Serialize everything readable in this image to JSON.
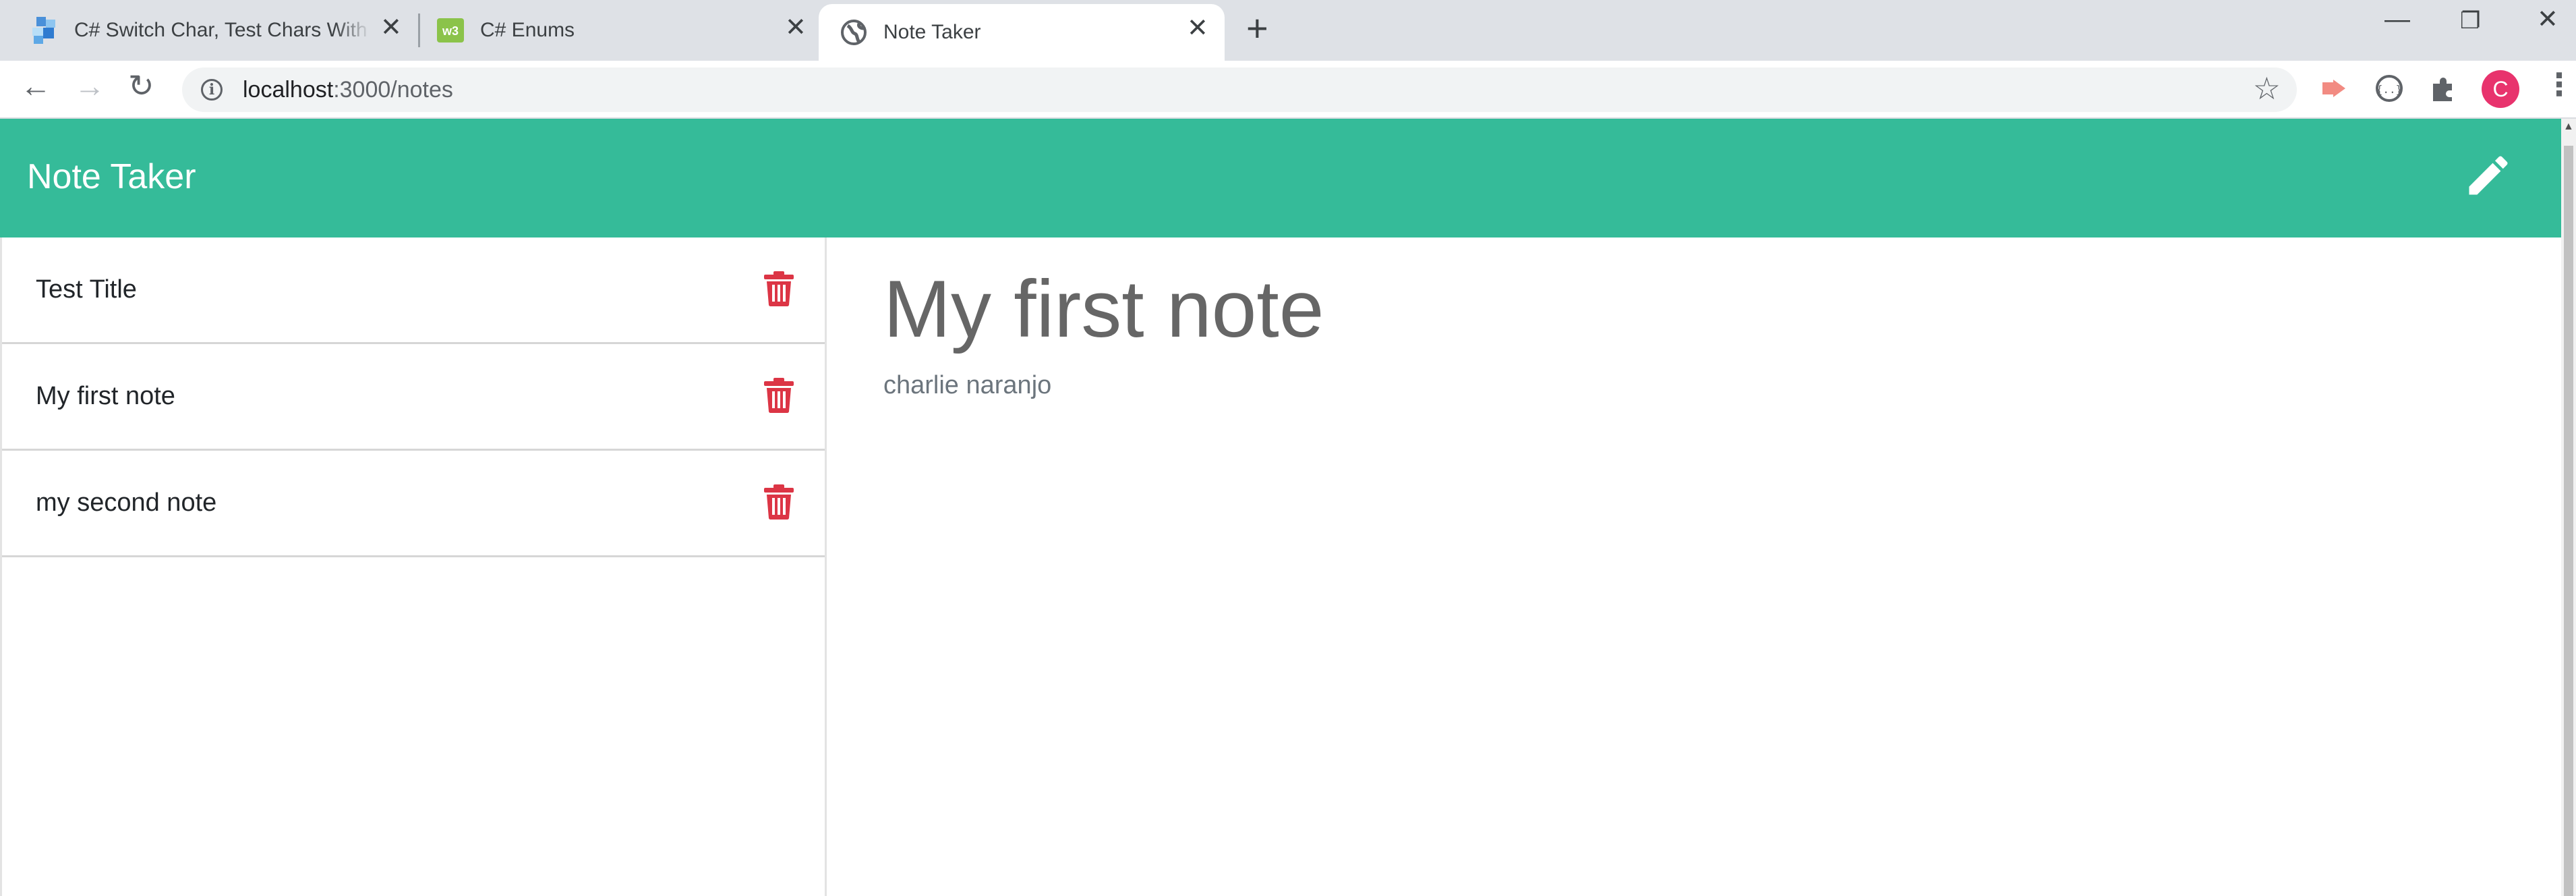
{
  "browser": {
    "tabs": [
      {
        "title": "C# Switch Char, Test Chars With Case",
        "icon": "dotnet-perls-icon",
        "active": false
      },
      {
        "title": "C# Enums",
        "icon": "w3schools-icon",
        "active": false
      },
      {
        "title": "Note Taker",
        "icon": "globe-icon",
        "active": true
      }
    ],
    "url_host": "localhost",
    "url_path": ":3000/notes",
    "avatar_letter": "C"
  },
  "app": {
    "brand": "Note Taker",
    "accent_color": "#35bb99",
    "delete_color": "#dc3545",
    "notes": [
      {
        "title": "Test Title"
      },
      {
        "title": "My first note"
      },
      {
        "title": "my second note"
      }
    ],
    "active_note": {
      "title": "My first note",
      "text": "charlie naranjo"
    }
  }
}
